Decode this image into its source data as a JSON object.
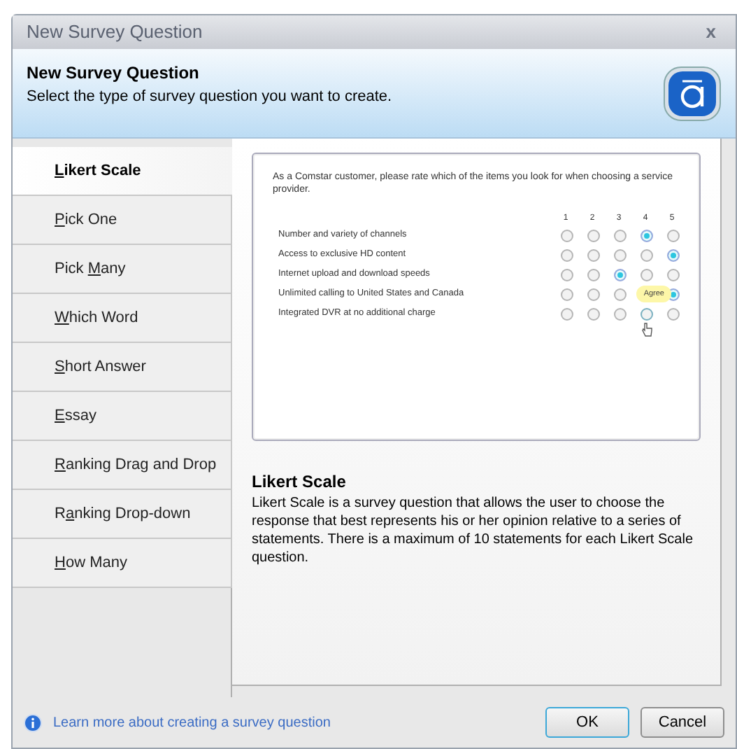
{
  "window": {
    "title": "New Survey Question",
    "close": "x"
  },
  "header": {
    "title": "New Survey Question",
    "subtitle": "Select the type of survey question you want to create."
  },
  "sidebar": {
    "items": [
      {
        "key": "L",
        "after": "ikert Scale",
        "selected": true
      },
      {
        "key": "P",
        "after": "ick One",
        "selected": false
      },
      {
        "before": "Pick ",
        "key": "M",
        "after": "any",
        "selected": false
      },
      {
        "key": "W",
        "after": "hich Word",
        "selected": false
      },
      {
        "key": "S",
        "after": "hort Answer",
        "selected": false
      },
      {
        "key": "E",
        "after": "ssay",
        "selected": false
      },
      {
        "key": "R",
        "after": "anking Drag and Drop",
        "selected": false
      },
      {
        "before": "R",
        "key": "a",
        "after": "nking Drop-down",
        "selected": false
      },
      {
        "key": "H",
        "after": "ow Many",
        "selected": false
      }
    ]
  },
  "preview": {
    "question": "As a Comstar customer, please rate which of the items you look for when choosing a service provider.",
    "columns": [
      "1",
      "2",
      "3",
      "4",
      "5"
    ],
    "rows": [
      {
        "statement": "Number and variety of channels",
        "choices": [
          {
            "kind": "radio",
            "selected": false
          },
          {
            "kind": "radio",
            "selected": false
          },
          {
            "kind": "radio",
            "selected": false
          },
          {
            "kind": "radio",
            "selected": true
          },
          {
            "kind": "radio",
            "selected": false
          }
        ]
      },
      {
        "statement": "Access to exclusive HD content",
        "choices": [
          {
            "kind": "radio",
            "selected": false
          },
          {
            "kind": "radio",
            "selected": false
          },
          {
            "kind": "radio",
            "selected": false
          },
          {
            "kind": "radio",
            "selected": false
          },
          {
            "kind": "radio",
            "selected": true
          }
        ]
      },
      {
        "statement": "Internet upload and download speeds",
        "choices": [
          {
            "kind": "radio",
            "selected": false
          },
          {
            "kind": "radio",
            "selected": false
          },
          {
            "kind": "radio",
            "selected": true
          },
          {
            "kind": "radio",
            "selected": false
          },
          {
            "kind": "radio",
            "selected": false
          }
        ]
      },
      {
        "statement": "Unlimited calling to United States and Canada",
        "choices": [
          {
            "kind": "radio",
            "selected": false
          },
          {
            "kind": "radio",
            "selected": false
          },
          {
            "kind": "radio",
            "selected": false
          },
          {
            "kind": "covered"
          },
          {
            "kind": "radio",
            "selected": true
          }
        ],
        "tooltip": "Agree"
      },
      {
        "statement": "Integrated DVR at no additional charge",
        "choices": [
          {
            "kind": "radio",
            "selected": false
          },
          {
            "kind": "radio",
            "selected": false
          },
          {
            "kind": "radio",
            "selected": false
          },
          {
            "kind": "hover",
            "selected": false
          },
          {
            "kind": "radio",
            "selected": false
          }
        ]
      }
    ]
  },
  "description": {
    "title": "Likert Scale",
    "text": "Likert Scale is a survey question that allows the user to choose the response that best represents his or her opinion relative to a series of statements. There is a maximum of 10 statements for each Likert Scale question."
  },
  "footer": {
    "link": "Learn more about creating a survey question",
    "buttons": [
      "OK",
      "Cancel"
    ]
  }
}
